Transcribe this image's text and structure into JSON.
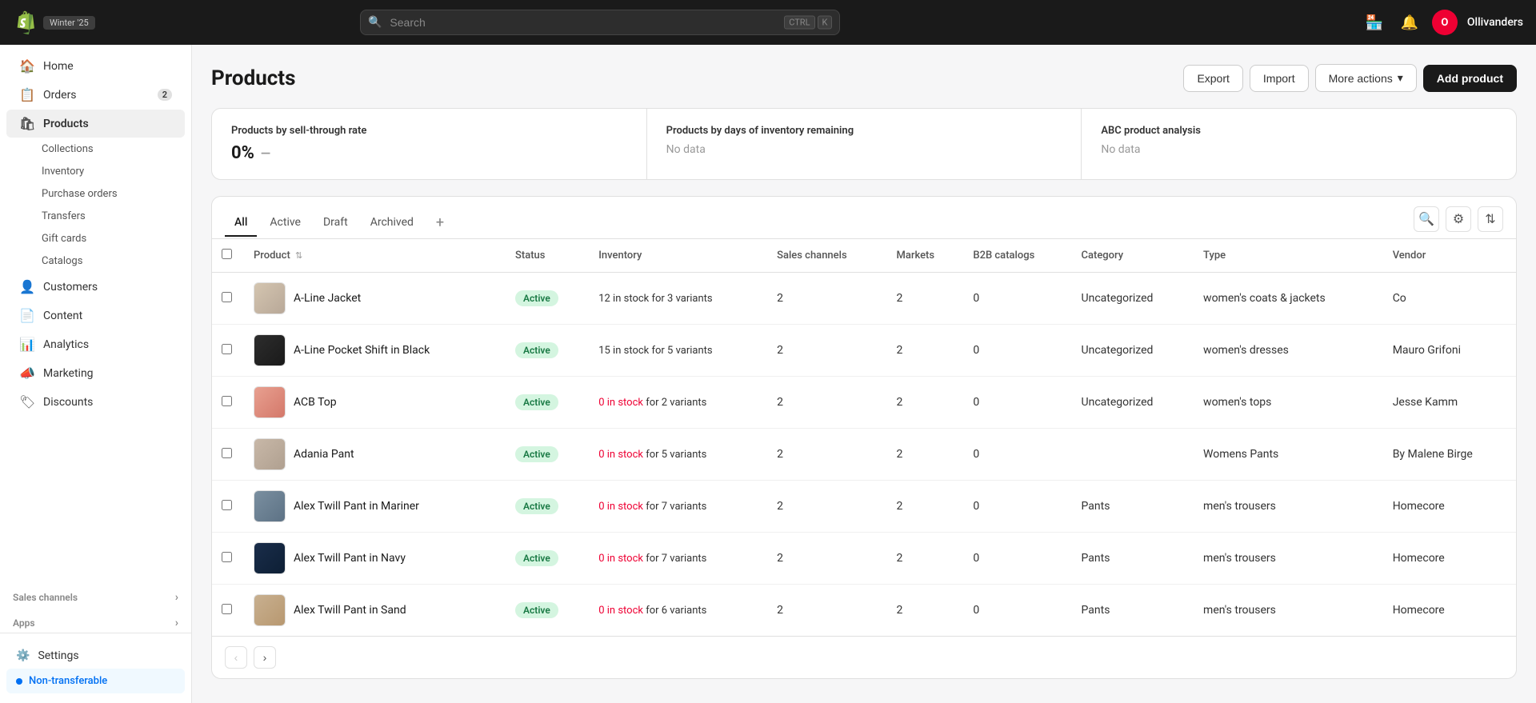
{
  "topbar": {
    "logo_alt": "Shopify",
    "badge": "Winter '25",
    "search_placeholder": "Search",
    "shortcut_ctrl": "CTRL",
    "shortcut_k": "K",
    "store_name": "Ollivanders"
  },
  "sidebar": {
    "items": [
      {
        "id": "home",
        "label": "Home",
        "icon": "🏠",
        "active": false
      },
      {
        "id": "orders",
        "label": "Orders",
        "icon": "📋",
        "badge": "2",
        "active": false
      },
      {
        "id": "products",
        "label": "Products",
        "icon": "🛍",
        "active": true
      },
      {
        "id": "customers",
        "label": "Customers",
        "icon": "👤",
        "active": false
      },
      {
        "id": "content",
        "label": "Content",
        "icon": "📄",
        "active": false
      },
      {
        "id": "analytics",
        "label": "Analytics",
        "icon": "📊",
        "active": false
      },
      {
        "id": "marketing",
        "label": "Marketing",
        "icon": "📣",
        "active": false
      },
      {
        "id": "discounts",
        "label": "Discounts",
        "icon": "🏷",
        "active": false
      }
    ],
    "products_sub": [
      {
        "id": "collections",
        "label": "Collections"
      },
      {
        "id": "inventory",
        "label": "Inventory"
      },
      {
        "id": "purchase_orders",
        "label": "Purchase orders"
      },
      {
        "id": "transfers",
        "label": "Transfers"
      },
      {
        "id": "gift_cards",
        "label": "Gift cards"
      },
      {
        "id": "catalogs",
        "label": "Catalogs"
      }
    ],
    "sections": [
      {
        "id": "sales_channels",
        "label": "Sales channels"
      },
      {
        "id": "apps",
        "label": "Apps"
      }
    ],
    "settings_label": "Settings",
    "non_transferable_label": "Non-transferable"
  },
  "header": {
    "title": "Products",
    "export_btn": "Export",
    "import_btn": "Import",
    "more_actions_btn": "More actions",
    "add_product_btn": "Add product"
  },
  "analytics_cards": [
    {
      "title": "Products by sell-through rate",
      "value": "0%",
      "secondary": "—"
    },
    {
      "title": "Products by days of inventory remaining",
      "nodata": "No data"
    },
    {
      "title": "ABC product analysis",
      "nodata": "No data"
    }
  ],
  "tabs": [
    {
      "id": "all",
      "label": "All",
      "active": true
    },
    {
      "id": "active",
      "label": "Active",
      "active": false
    },
    {
      "id": "draft",
      "label": "Draft",
      "active": false
    },
    {
      "id": "archived",
      "label": "Archived",
      "active": false
    }
  ],
  "table": {
    "columns": [
      {
        "id": "product",
        "label": "Product",
        "sortable": true
      },
      {
        "id": "status",
        "label": "Status"
      },
      {
        "id": "inventory",
        "label": "Inventory"
      },
      {
        "id": "sales_channels",
        "label": "Sales channels"
      },
      {
        "id": "markets",
        "label": "Markets"
      },
      {
        "id": "b2b_catalogs",
        "label": "B2B catalogs"
      },
      {
        "id": "category",
        "label": "Category"
      },
      {
        "id": "type",
        "label": "Type"
      },
      {
        "id": "vendor",
        "label": "Vendor"
      }
    ],
    "rows": [
      {
        "name": "A-Line Jacket",
        "status": "Active",
        "inventory": "12 in stock for 3 variants",
        "inventory_zero": false,
        "sales_channels": "2",
        "markets": "2",
        "b2b_catalogs": "0",
        "category": "Uncategorized",
        "type": "women's coats & jackets",
        "vendor": "Co",
        "thumb_class": "thumb-aline-jacket"
      },
      {
        "name": "A-Line Pocket Shift in Black",
        "status": "Active",
        "inventory": "15 in stock for 5 variants",
        "inventory_zero": false,
        "sales_channels": "2",
        "markets": "2",
        "b2b_catalogs": "0",
        "category": "Uncategorized",
        "type": "women's dresses",
        "vendor": "Mauro Grifoni",
        "thumb_class": "thumb-aline-pocket"
      },
      {
        "name": "ACB Top",
        "status": "Active",
        "inventory": "0 in stock for 2 variants",
        "inventory_zero": true,
        "inventory_suffix": " for 2 variants",
        "sales_channels": "2",
        "markets": "2",
        "b2b_catalogs": "0",
        "category": "Uncategorized",
        "type": "women's tops",
        "vendor": "Jesse Kamm",
        "thumb_class": "thumb-acb-top"
      },
      {
        "name": "Adania Pant",
        "status": "Active",
        "inventory": "0 in stock for 5 variants",
        "inventory_zero": true,
        "inventory_suffix": " for 5 variants",
        "sales_channels": "2",
        "markets": "2",
        "b2b_catalogs": "0",
        "category": "",
        "type": "Womens Pants",
        "vendor": "By Malene Birge",
        "thumb_class": "thumb-adania-pant"
      },
      {
        "name": "Alex Twill Pant in Mariner",
        "status": "Active",
        "inventory": "0 in stock for 7 variants",
        "inventory_zero": true,
        "inventory_suffix": " for 7 variants",
        "sales_channels": "2",
        "markets": "2",
        "b2b_catalogs": "0",
        "category": "Pants",
        "type": "men's trousers",
        "vendor": "Homecore",
        "thumb_class": "thumb-alex-mariner"
      },
      {
        "name": "Alex Twill Pant in Navy",
        "status": "Active",
        "inventory": "0 in stock for 7 variants",
        "inventory_zero": true,
        "inventory_suffix": " for 7 variants",
        "sales_channels": "2",
        "markets": "2",
        "b2b_catalogs": "0",
        "category": "Pants",
        "type": "men's trousers",
        "vendor": "Homecore",
        "thumb_class": "thumb-alex-navy"
      },
      {
        "name": "Alex Twill Pant in Sand",
        "status": "Active",
        "inventory": "0 in stock for 6 variants",
        "inventory_zero": true,
        "inventory_suffix": " for 6 variants",
        "sales_channels": "2",
        "markets": "2",
        "b2b_catalogs": "0",
        "category": "Pants",
        "type": "men's trousers",
        "vendor": "Homecore",
        "thumb_class": "thumb-alex-sand"
      }
    ]
  }
}
